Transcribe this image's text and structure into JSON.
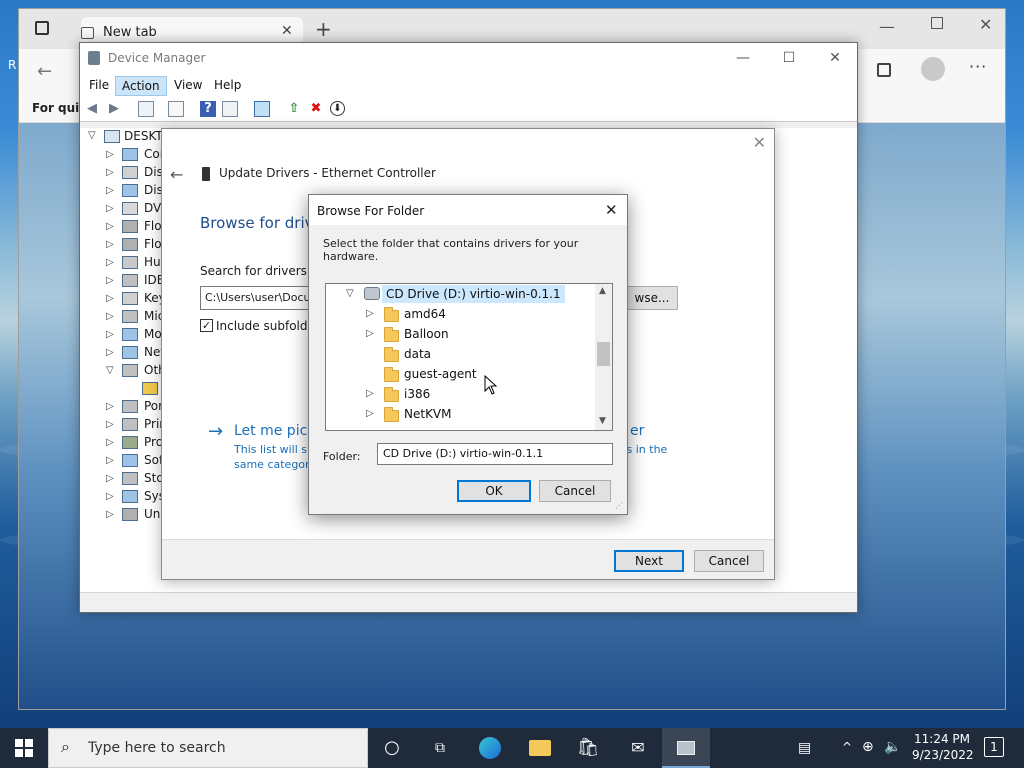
{
  "edge": {
    "tab_title": "New tab",
    "fav_label": "For quick",
    "left_cut_label": "R"
  },
  "device_manager": {
    "title": "Device Manager",
    "menu": [
      "File",
      "Action",
      "View",
      "Help"
    ],
    "root": "DESKTO",
    "items": [
      "Cor",
      "Disk",
      "Disp",
      "DVD",
      "Flop",
      "Flop",
      "Hun",
      "IDE",
      "Key",
      "Mic",
      "Mo",
      "Net",
      "Oth",
      "",
      "Por",
      "Prin",
      "Pro",
      "Soft",
      "Stor",
      "Syst",
      "Uni"
    ]
  },
  "wizard": {
    "title": "Update Drivers - Ethernet Controller",
    "heading": "Browse for drive",
    "search_label": "Search for drivers in t",
    "path_value": "C:\\Users\\user\\Docu",
    "browse_label": "wse...",
    "include_sub": "Include subfolder",
    "let_me_pick": "Let me pick",
    "let_me_pick_right": "er",
    "desc_line1": "This list will sh",
    "desc_line2": "same category",
    "desc_right": "rs in the",
    "next": "Next",
    "cancel": "Cancel"
  },
  "browse_folder": {
    "title": "Browse For Folder",
    "instruction": "Select the folder that contains drivers for your hardware.",
    "drive": "CD Drive (D:) virtio-win-0.1.1",
    "folders": [
      "amd64",
      "Balloon",
      "data",
      "guest-agent",
      "i386",
      "NetKVM"
    ],
    "folder_label": "Folder:",
    "folder_value": "CD Drive (D:) virtio-win-0.1.1",
    "ok": "OK",
    "cancel": "Cancel"
  },
  "taskbar": {
    "search_placeholder": "Type here to search",
    "time": "11:24 PM",
    "date": "9/23/2022",
    "notification_count": "1"
  },
  "colors": {
    "accent": "#0078d7",
    "link": "#1a6fb8",
    "taskbar": "#1f2a3a",
    "selection": "#cce8ff"
  }
}
